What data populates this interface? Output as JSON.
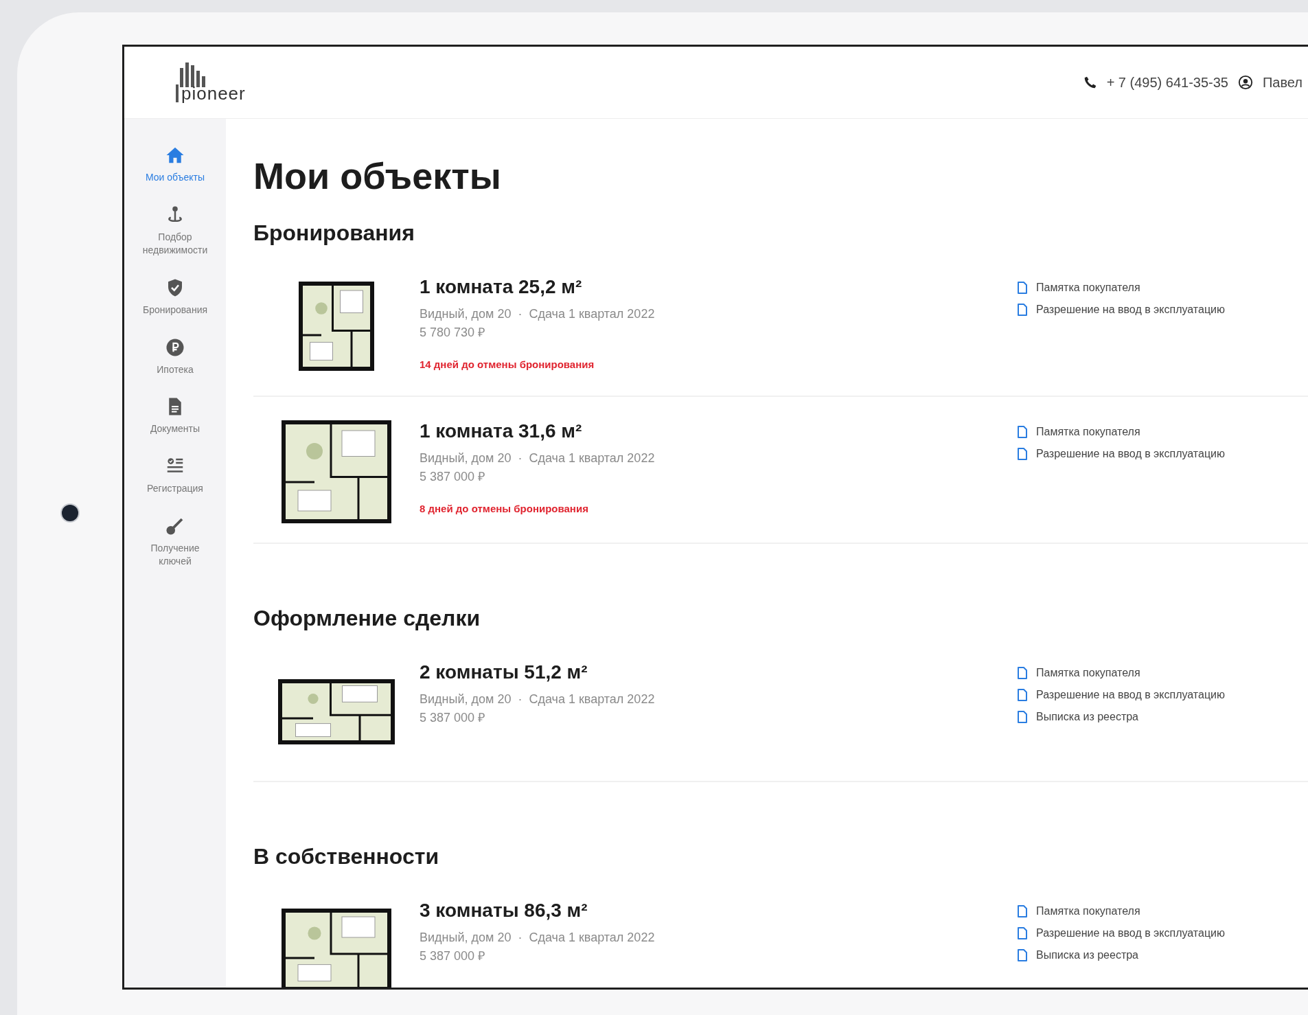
{
  "logo": {
    "text": "pioneer"
  },
  "header": {
    "phone": "+ 7 (495) 641-35-35",
    "user": "Павел"
  },
  "sidebar": {
    "items": [
      {
        "kind": "home",
        "label": "Мои объекты",
        "selected": true
      },
      {
        "kind": "pin",
        "label": "Подбор недвижимости",
        "selected": false
      },
      {
        "kind": "shield",
        "label": "Бронирования",
        "selected": false
      },
      {
        "kind": "ruble",
        "label": "Ипотека",
        "selected": false
      },
      {
        "kind": "doc",
        "label": "Документы",
        "selected": false
      },
      {
        "kind": "list",
        "label": "Регистрация",
        "selected": false
      },
      {
        "kind": "key",
        "label": "Получение ключей",
        "selected": false
      }
    ]
  },
  "page_title": "Мои объекты",
  "sections": [
    {
      "title": "Бронирования",
      "cards": [
        {
          "title": "1 комната 25,2 м²",
          "location": "Видный, дом 20",
          "separator": "·",
          "handover": "Сдача 1 квартал 2022",
          "price": "5 780 730 ₽",
          "warning": "14 дней до отмены бронирования",
          "docs": [
            "Памятка покупателя",
            "Разрешение на ввод в эксплуатацию"
          ]
        },
        {
          "title": "1 комната 31,6 м²",
          "location": "Видный, дом 20",
          "separator": "·",
          "handover": "Сдача 1 квартал 2022",
          "price": "5 387 000 ₽",
          "warning": "8 дней до отмены бронирования",
          "docs": [
            "Памятка покупателя",
            "Разрешение на ввод в эксплуатацию"
          ]
        }
      ]
    },
    {
      "title": "Оформление сделки",
      "cards": [
        {
          "title": "2 комнаты 51,2 м²",
          "location": "Видный, дом 20",
          "separator": "·",
          "handover": "Сдача 1 квартал 2022",
          "price": "5 387 000 ₽",
          "docs": [
            "Памятка покупателя",
            "Разрешение на ввод в эксплуатацию",
            "Выписка из реестра"
          ]
        }
      ]
    },
    {
      "title": "В собственности",
      "cards": [
        {
          "title": "3 комнаты 86,3 м²",
          "location": "Видный, дом 20",
          "separator": "·",
          "handover": "Сдача 1 квартал 2022",
          "price": "5 387 000 ₽",
          "docs": [
            "Памятка покупателя",
            "Разрешение на ввод в эксплуатацию",
            "Выписка из реестра"
          ]
        }
      ]
    }
  ]
}
